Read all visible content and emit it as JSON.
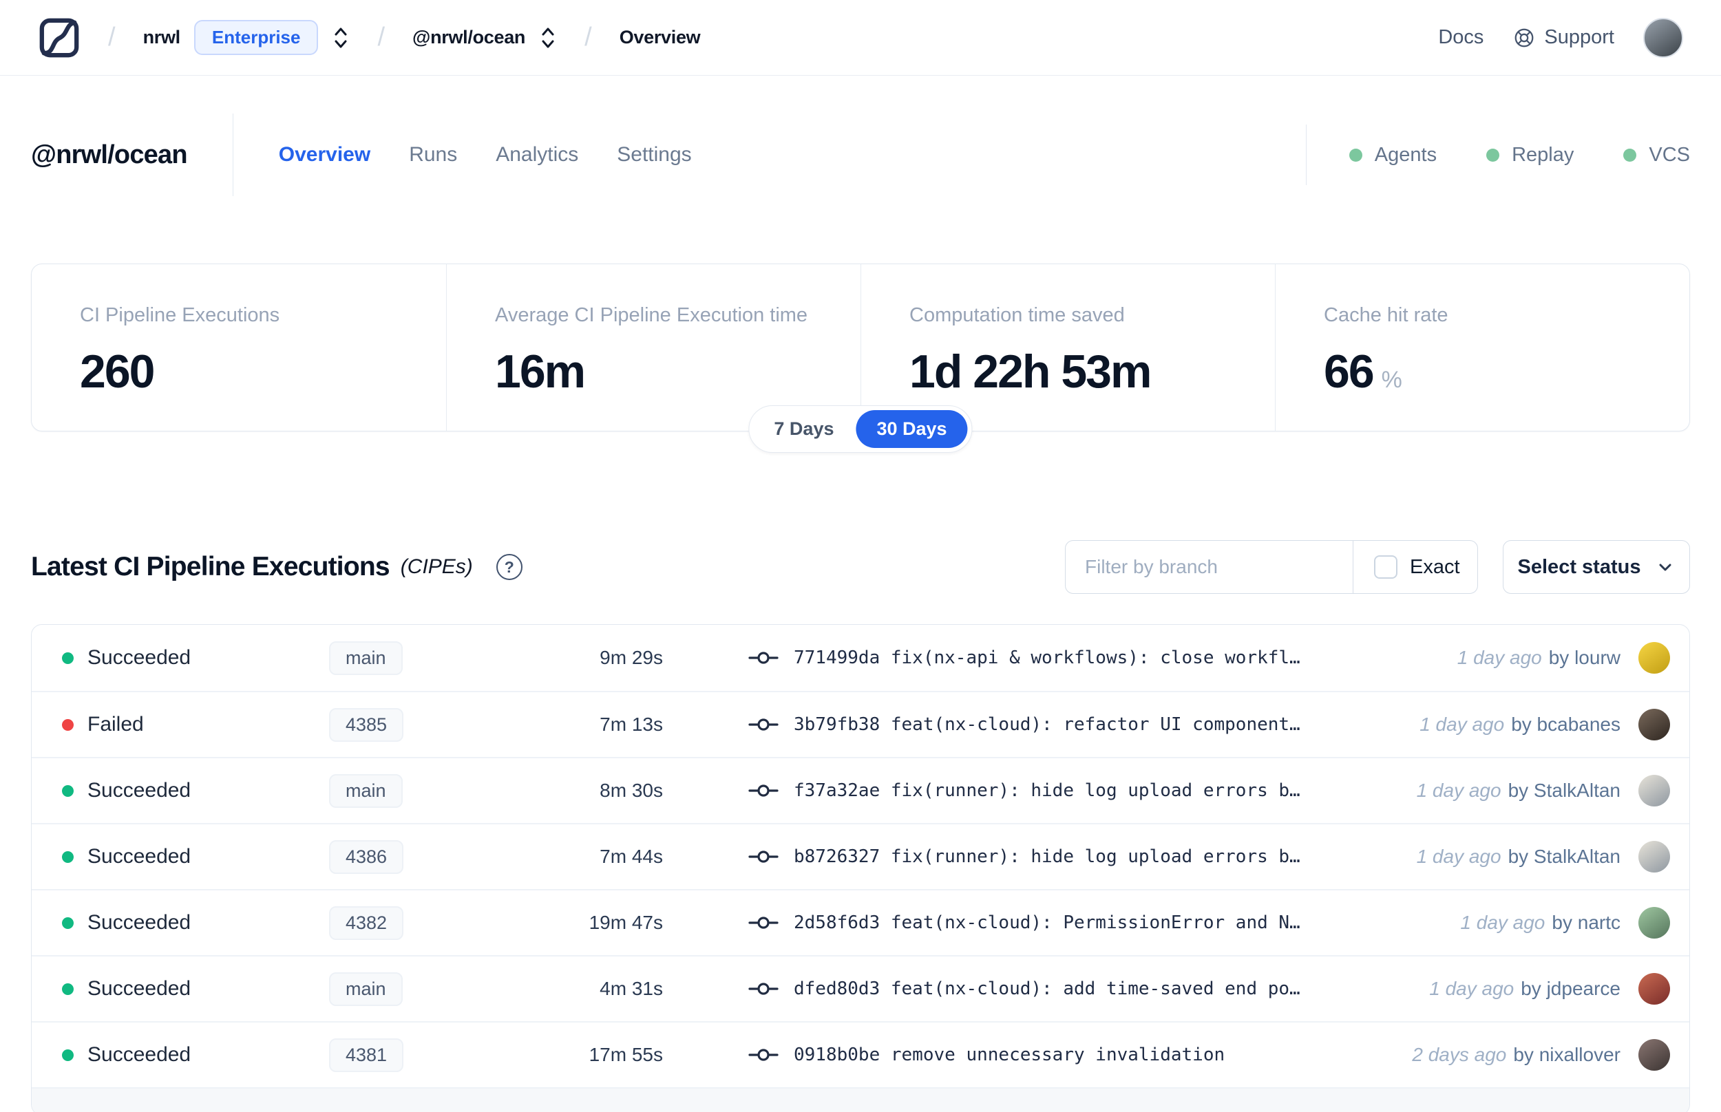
{
  "topbar": {
    "breadcrumb": {
      "org": "nrwl",
      "org_badge": "Enterprise",
      "workspace": "@nrwl/ocean",
      "page": "Overview"
    },
    "docs": "Docs",
    "support": "Support",
    "user_avatar": {
      "from": "#98a1ab",
      "to": "#3c4349"
    }
  },
  "header": {
    "title": "@nrwl/ocean",
    "tabs": [
      {
        "label": "Overview",
        "active": true
      },
      {
        "label": "Runs",
        "active": false
      },
      {
        "label": "Analytics",
        "active": false
      },
      {
        "label": "Settings",
        "active": false
      }
    ],
    "features": [
      {
        "label": "Agents",
        "status_color": "#7cc79e"
      },
      {
        "label": "Replay",
        "status_color": "#7cc79e"
      },
      {
        "label": "VCS",
        "status_color": "#7cc79e"
      }
    ]
  },
  "stats": {
    "cards": [
      {
        "label": "CI Pipeline Executions",
        "value": "260",
        "unit": ""
      },
      {
        "label": "Average CI Pipeline Execution time",
        "value": "16m",
        "unit": ""
      },
      {
        "label": "Computation time saved",
        "value": "1d 22h 53m",
        "unit": ""
      },
      {
        "label": "Cache hit rate",
        "value": "66",
        "unit": "%"
      }
    ],
    "range_toggle": {
      "options": [
        "7 Days",
        "30 Days"
      ],
      "selected": "30 Days",
      "accent": "#2563eb"
    }
  },
  "cipes": {
    "title": "Latest CI Pipeline Executions",
    "suffix": "(CIPEs)",
    "filter": {
      "placeholder": "Filter by branch",
      "value": "",
      "exact_label": "Exact",
      "exact_checked": false
    },
    "status_select": "Select status",
    "rows": [
      {
        "status": "Succeeded",
        "status_color": "#10b981",
        "branch": "main",
        "duration": "9m 29s",
        "commit": "771499da",
        "message": "fix(nx-api & workflows): close workfl…",
        "time": "1 day ago",
        "author": "by lourw",
        "avatar": {
          "from": "#f6d544",
          "to": "#c19e14"
        }
      },
      {
        "status": "Failed",
        "status_color": "#ef4444",
        "branch": "4385",
        "duration": "7m 13s",
        "commit": "3b79fb38",
        "message": "feat(nx-cloud): refactor UI component…",
        "time": "1 day ago",
        "author": "by bcabanes",
        "avatar": {
          "from": "#7a6a5c",
          "to": "#2e2620"
        }
      },
      {
        "status": "Succeeded",
        "status_color": "#10b981",
        "branch": "main",
        "duration": "8m 30s",
        "commit": "f37a32ae",
        "message": "fix(runner): hide log upload errors b…",
        "time": "1 day ago",
        "author": "by StalkAltan",
        "avatar": {
          "from": "#e7e3d9",
          "to": "#8f98a1"
        }
      },
      {
        "status": "Succeeded",
        "status_color": "#10b981",
        "branch": "4386",
        "duration": "7m 44s",
        "commit": "b8726327",
        "message": "fix(runner): hide log upload errors b…",
        "time": "1 day ago",
        "author": "by StalkAltan",
        "avatar": {
          "from": "#e7e3d9",
          "to": "#8f98a1"
        }
      },
      {
        "status": "Succeeded",
        "status_color": "#10b981",
        "branch": "4382",
        "duration": "19m 47s",
        "commit": "2d58f6d3",
        "message": "feat(nx-cloud): PermissionError and N…",
        "time": "1 day ago",
        "author": "by nartc",
        "avatar": {
          "from": "#9fc7a1",
          "to": "#55755c"
        }
      },
      {
        "status": "Succeeded",
        "status_color": "#10b981",
        "branch": "main",
        "duration": "4m 31s",
        "commit": "dfed80d3",
        "message": "feat(nx-cloud): add time-saved end po…",
        "time": "1 day ago",
        "author": "by jdpearce",
        "avatar": {
          "from": "#c96a52",
          "to": "#7a2d2a"
        }
      },
      {
        "status": "Succeeded",
        "status_color": "#10b981",
        "branch": "4381",
        "duration": "17m 55s",
        "commit": "0918b0be",
        "message": "remove unnecessary invalidation",
        "time": "2 days ago",
        "author": "by nixallover",
        "avatar": {
          "from": "#8a7672",
          "to": "#3b3432"
        }
      }
    ]
  }
}
